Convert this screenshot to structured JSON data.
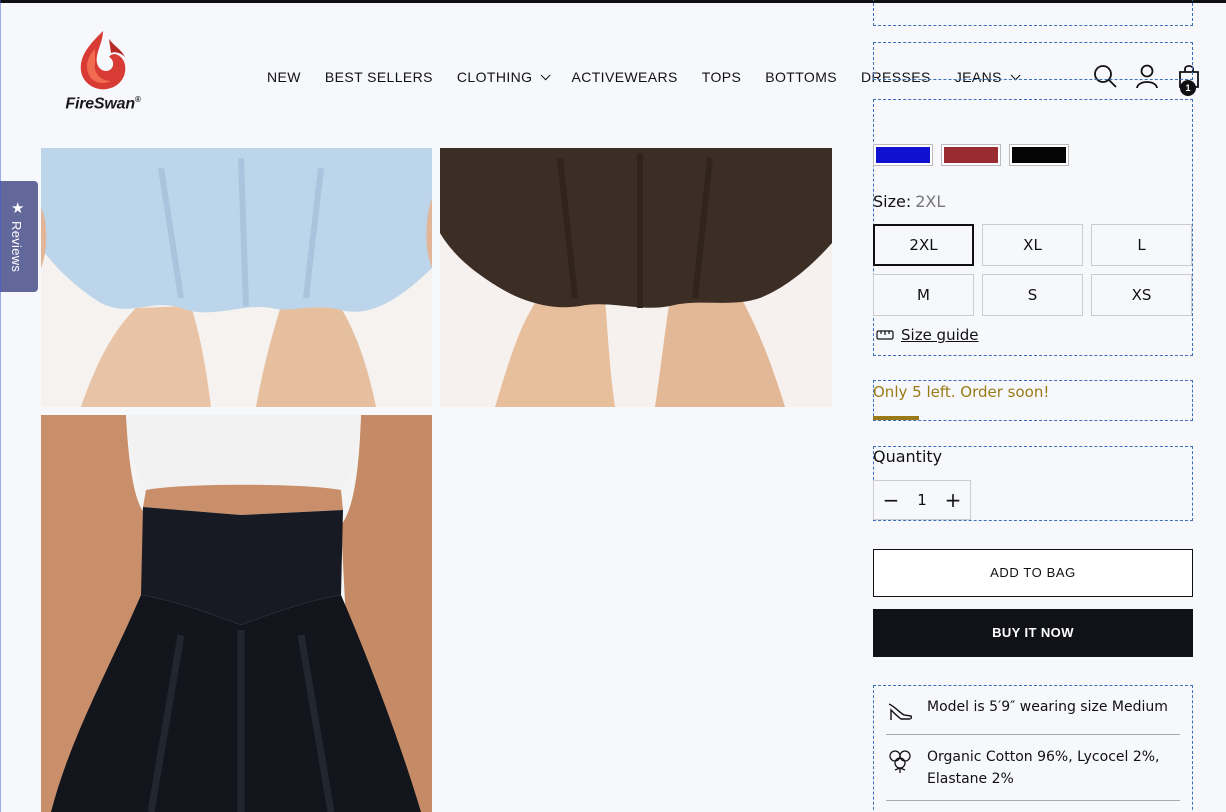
{
  "brand": {
    "name": "FireSwan",
    "registered_mark": "®"
  },
  "nav": {
    "items": [
      {
        "label": "NEW",
        "has_dropdown": false
      },
      {
        "label": "BEST SELLERS",
        "has_dropdown": false
      },
      {
        "label": "CLOTHING",
        "has_dropdown": true
      },
      {
        "label": "ACTIVEWEARS",
        "has_dropdown": false
      },
      {
        "label": "TOPS",
        "has_dropdown": false
      },
      {
        "label": "BOTTOMS",
        "has_dropdown": false
      },
      {
        "label": "DRESSES",
        "has_dropdown": false
      },
      {
        "label": "JEANS",
        "has_dropdown": true
      }
    ]
  },
  "header_icons": {
    "search": "search-icon",
    "account": "account-icon",
    "cart": "shopping-bag-icon",
    "cart_count": "1"
  },
  "reviews_tab": {
    "label": "Reviews",
    "icon": "star-icon"
  },
  "gallery": {
    "images": [
      {
        "name": "light-blue-skort-photo",
        "color": "#b9d3e8"
      },
      {
        "name": "brown-skort-photo",
        "color": "#3e2f26"
      },
      {
        "name": "black-skort-photo",
        "color": "#15181f"
      }
    ]
  },
  "color_swatches": [
    {
      "name": "blue",
      "hex": "#1010d0"
    },
    {
      "name": "red",
      "hex": "#9a2b31"
    },
    {
      "name": "black",
      "hex": "#050505"
    }
  ],
  "size": {
    "label": "Size:",
    "selected": "2XL",
    "options": [
      "2XL",
      "XL",
      "L",
      "M",
      "S",
      "XS"
    ],
    "guide_label": "Size guide"
  },
  "stock": {
    "message": "Only 5 left. Order soon!",
    "color": "#9a7a16"
  },
  "quantity": {
    "label": "Quantity",
    "value": "1",
    "decrease": "−",
    "increase": "+"
  },
  "buttons": {
    "add_to_bag": "ADD TO BAG",
    "buy_now": "BUY IT NOW"
  },
  "details": [
    {
      "icon": "high-heel-icon",
      "text": "Model is 5′9″ wearing size Medium"
    },
    {
      "icon": "cotton-flower-icon",
      "text": "Organic Cotton 96%, Lycocel 2%, Elastane 2%"
    }
  ]
}
